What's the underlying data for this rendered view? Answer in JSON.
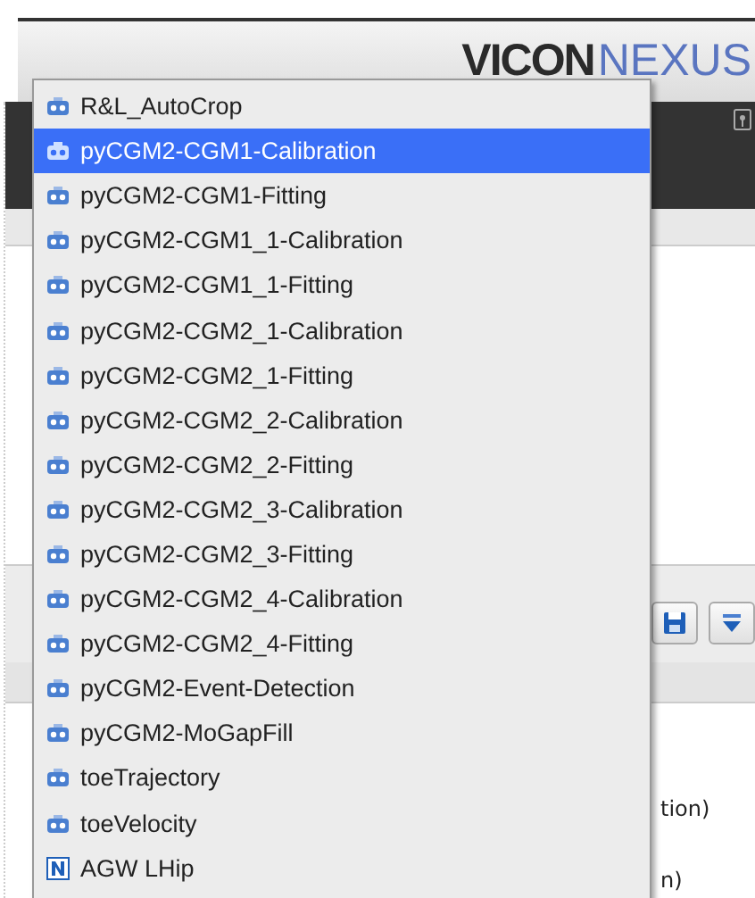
{
  "header": {
    "logo_bold": "VICON",
    "logo_light": "NEXUS"
  },
  "background_panel": {
    "partial_texts": [
      "tion)",
      "n)"
    ]
  },
  "dropdown": {
    "items": [
      {
        "label": "R&L_AutoCrop",
        "kind": "pipeline",
        "selected": false
      },
      {
        "label": "pyCGM2-CGM1-Calibration",
        "kind": "pipeline",
        "selected": true
      },
      {
        "label": "pyCGM2-CGM1-Fitting",
        "kind": "pipeline",
        "selected": false
      },
      {
        "label": "pyCGM2-CGM1_1-Calibration",
        "kind": "pipeline",
        "selected": false
      },
      {
        "label": "pyCGM2-CGM1_1-Fitting",
        "kind": "pipeline",
        "selected": false
      },
      {
        "label": "pyCGM2-CGM2_1-Calibration",
        "kind": "pipeline",
        "selected": false
      },
      {
        "label": "pyCGM2-CGM2_1-Fitting",
        "kind": "pipeline",
        "selected": false
      },
      {
        "label": "pyCGM2-CGM2_2-Calibration",
        "kind": "pipeline",
        "selected": false
      },
      {
        "label": "pyCGM2-CGM2_2-Fitting",
        "kind": "pipeline",
        "selected": false
      },
      {
        "label": "pyCGM2-CGM2_3-Calibration",
        "kind": "pipeline",
        "selected": false
      },
      {
        "label": "pyCGM2-CGM2_3-Fitting",
        "kind": "pipeline",
        "selected": false
      },
      {
        "label": "pyCGM2-CGM2_4-Calibration",
        "kind": "pipeline",
        "selected": false
      },
      {
        "label": "pyCGM2-CGM2_4-Fitting",
        "kind": "pipeline",
        "selected": false
      },
      {
        "label": "pyCGM2-Event-Detection",
        "kind": "pipeline",
        "selected": false
      },
      {
        "label": "pyCGM2-MoGapFill",
        "kind": "pipeline",
        "selected": false
      },
      {
        "label": "toeTrajectory",
        "kind": "pipeline",
        "selected": false
      },
      {
        "label": "toeVelocity",
        "kind": "pipeline",
        "selected": false
      },
      {
        "label": "AGW LHip",
        "kind": "nexus",
        "selected": false
      }
    ]
  }
}
